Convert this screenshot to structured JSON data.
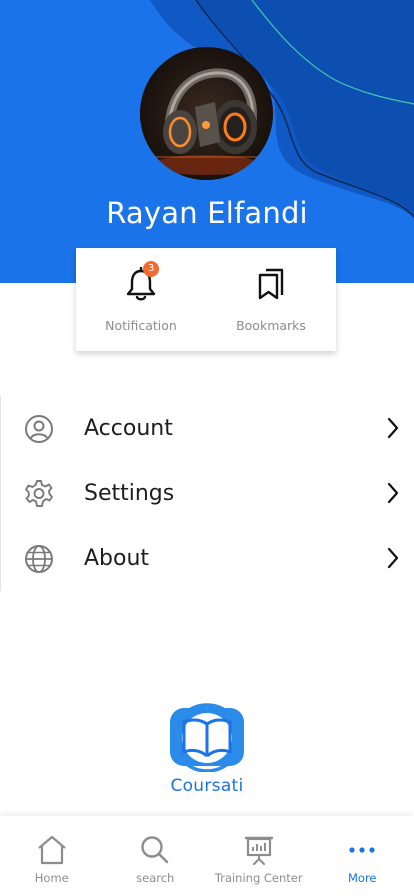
{
  "profile": {
    "name": "Rayan Elfandi",
    "avatar": "robot-headphones-avatar"
  },
  "quick_actions": {
    "notification": {
      "label": "Notification",
      "badge": "3",
      "icon": "bell-icon"
    },
    "bookmarks": {
      "label": "Bookmarks",
      "icon": "bookmarks-icon"
    }
  },
  "menu": {
    "items": [
      {
        "label": "Account",
        "icon": "user-circle-icon"
      },
      {
        "label": "Settings",
        "icon": "gear-icon"
      },
      {
        "label": "About",
        "icon": "globe-icon"
      }
    ]
  },
  "logo": {
    "text": "Coursati"
  },
  "nav": {
    "items": [
      {
        "label": "Home",
        "icon": "home-icon"
      },
      {
        "label": "search",
        "icon": "search-icon"
      },
      {
        "label": "Training Center",
        "icon": "presentation-icon"
      },
      {
        "label": "More",
        "icon": "more-dots-icon",
        "active": true
      }
    ]
  },
  "colors": {
    "primary": "#1a73e8",
    "header_dark": "#0f4fb4",
    "badge": "#f26a2e"
  }
}
